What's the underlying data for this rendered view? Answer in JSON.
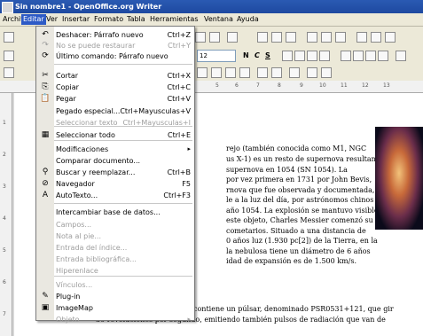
{
  "window": {
    "title": "Sin nombre1 - OpenOffice.org Writer"
  },
  "menubar": [
    "Archivo",
    "Editar",
    "Ver",
    "Insertar",
    "Formato",
    "Tabla",
    "Herramientas",
    "Ventana",
    "Ayuda"
  ],
  "toolbar": {
    "font_size": "12",
    "bold": "N",
    "italic": "C",
    "underline": "S"
  },
  "ruler": [
    "5",
    "6",
    "7",
    "8",
    "9",
    "10",
    "11",
    "12",
    "13"
  ],
  "vruler": [
    "1",
    "2",
    "3",
    "4",
    "5",
    "6",
    "7"
  ],
  "edit_menu": [
    {
      "label": "Deshacer: Párrafo nuevo",
      "shortcut": "Ctrl+Z",
      "icon": "undo-icon",
      "glyph": "↶",
      "disabled": false
    },
    {
      "label": "No se puede restaurar",
      "shortcut": "Ctrl+Y",
      "icon": "redo-icon",
      "glyph": "↷",
      "disabled": true
    },
    {
      "label": "Último comando: Párrafo nuevo",
      "shortcut": "",
      "icon": "repeat-icon",
      "glyph": "⟳",
      "disabled": false
    },
    {
      "label": "Cortar",
      "shortcut": "Ctrl+X",
      "icon": "cut-icon",
      "glyph": "✂",
      "disabled": false
    },
    {
      "label": "Copiar",
      "shortcut": "Ctrl+C",
      "icon": "copy-icon",
      "glyph": "⎘",
      "disabled": false
    },
    {
      "label": "Pegar",
      "shortcut": "Ctrl+V",
      "icon": "paste-icon",
      "glyph": "📋",
      "disabled": false
    },
    {
      "label": "Pegado especial...",
      "shortcut": "Ctrl+Mayusculas+V",
      "icon": "",
      "glyph": "",
      "disabled": false
    },
    {
      "label": "Seleccionar texto",
      "shortcut": "Ctrl+Mayusculas+I",
      "icon": "",
      "glyph": "",
      "disabled": true
    },
    {
      "label": "Seleccionar todo",
      "shortcut": "Ctrl+E",
      "icon": "select-all-icon",
      "glyph": "▦",
      "disabled": false
    },
    {
      "label": "Modificaciones",
      "shortcut": "",
      "icon": "",
      "glyph": "",
      "disabled": false,
      "submenu": true
    },
    {
      "label": "Comparar documento...",
      "shortcut": "",
      "icon": "",
      "glyph": "",
      "disabled": false
    },
    {
      "label": "Buscar y reemplazar...",
      "shortcut": "Ctrl+B",
      "icon": "binoculars-icon",
      "glyph": "⚲",
      "disabled": false
    },
    {
      "label": "Navegador",
      "shortcut": "F5",
      "icon": "navigator-icon",
      "glyph": "⊘",
      "disabled": false
    },
    {
      "label": "AutoTexto...",
      "shortcut": "Ctrl+F3",
      "icon": "autotext-icon",
      "glyph": "A",
      "disabled": false
    },
    {
      "label": "Intercambiar base de datos...",
      "shortcut": "",
      "icon": "",
      "glyph": "",
      "disabled": false
    },
    {
      "label": "Campos...",
      "shortcut": "",
      "icon": "",
      "glyph": "",
      "disabled": true
    },
    {
      "label": "Nota al pie...",
      "shortcut": "",
      "icon": "",
      "glyph": "",
      "disabled": true
    },
    {
      "label": "Entrada del índice...",
      "shortcut": "",
      "icon": "",
      "glyph": "",
      "disabled": true
    },
    {
      "label": "Entrada bibliográfica...",
      "shortcut": "",
      "icon": "",
      "glyph": "",
      "disabled": true
    },
    {
      "label": "Hiperenlace",
      "shortcut": "",
      "icon": "",
      "glyph": "",
      "disabled": true
    },
    {
      "label": "Vínculos...",
      "shortcut": "",
      "icon": "",
      "glyph": "",
      "disabled": true
    },
    {
      "label": "Plug-in",
      "shortcut": "",
      "icon": "plugin-icon",
      "glyph": "✎",
      "disabled": false
    },
    {
      "label": "ImageMap",
      "shortcut": "",
      "icon": "imagemap-icon",
      "glyph": "▣",
      "disabled": false
    },
    {
      "label": "Objeto",
      "shortcut": "",
      "icon": "",
      "glyph": "",
      "disabled": true,
      "submenu": true
    }
  ],
  "document_lines": [
    "rejo (también conocida como M1, NGC",
    "us X-1) es un resto de supernova resultante",
    "supernova en 1054 (SN 1054). La",
    "por vez primera en 1731 por John Bevis,",
    "rnova que fue observada y documentada,",
    "le a la luz del día, por astrónomos chinos y",
    "año 1054. La explosión se mantuvo visible",
    "este objeto, Charles Messier comenzó su",
    "cometarios. Situado a una distancia de",
    "0 años luz (1.930 pc[2]) de la Tierra, en la",
    "la nebulosa tiene un diámetro de 6 años",
    "idad de expansión es de 1.500 km/s."
  ],
  "bottom_lines": [
    "contiene un púlsar, denominado PSR0531+121, que gir",
    "30 revoluciones por segundo, emitiendo también pulsos de radiación que van de"
  ]
}
